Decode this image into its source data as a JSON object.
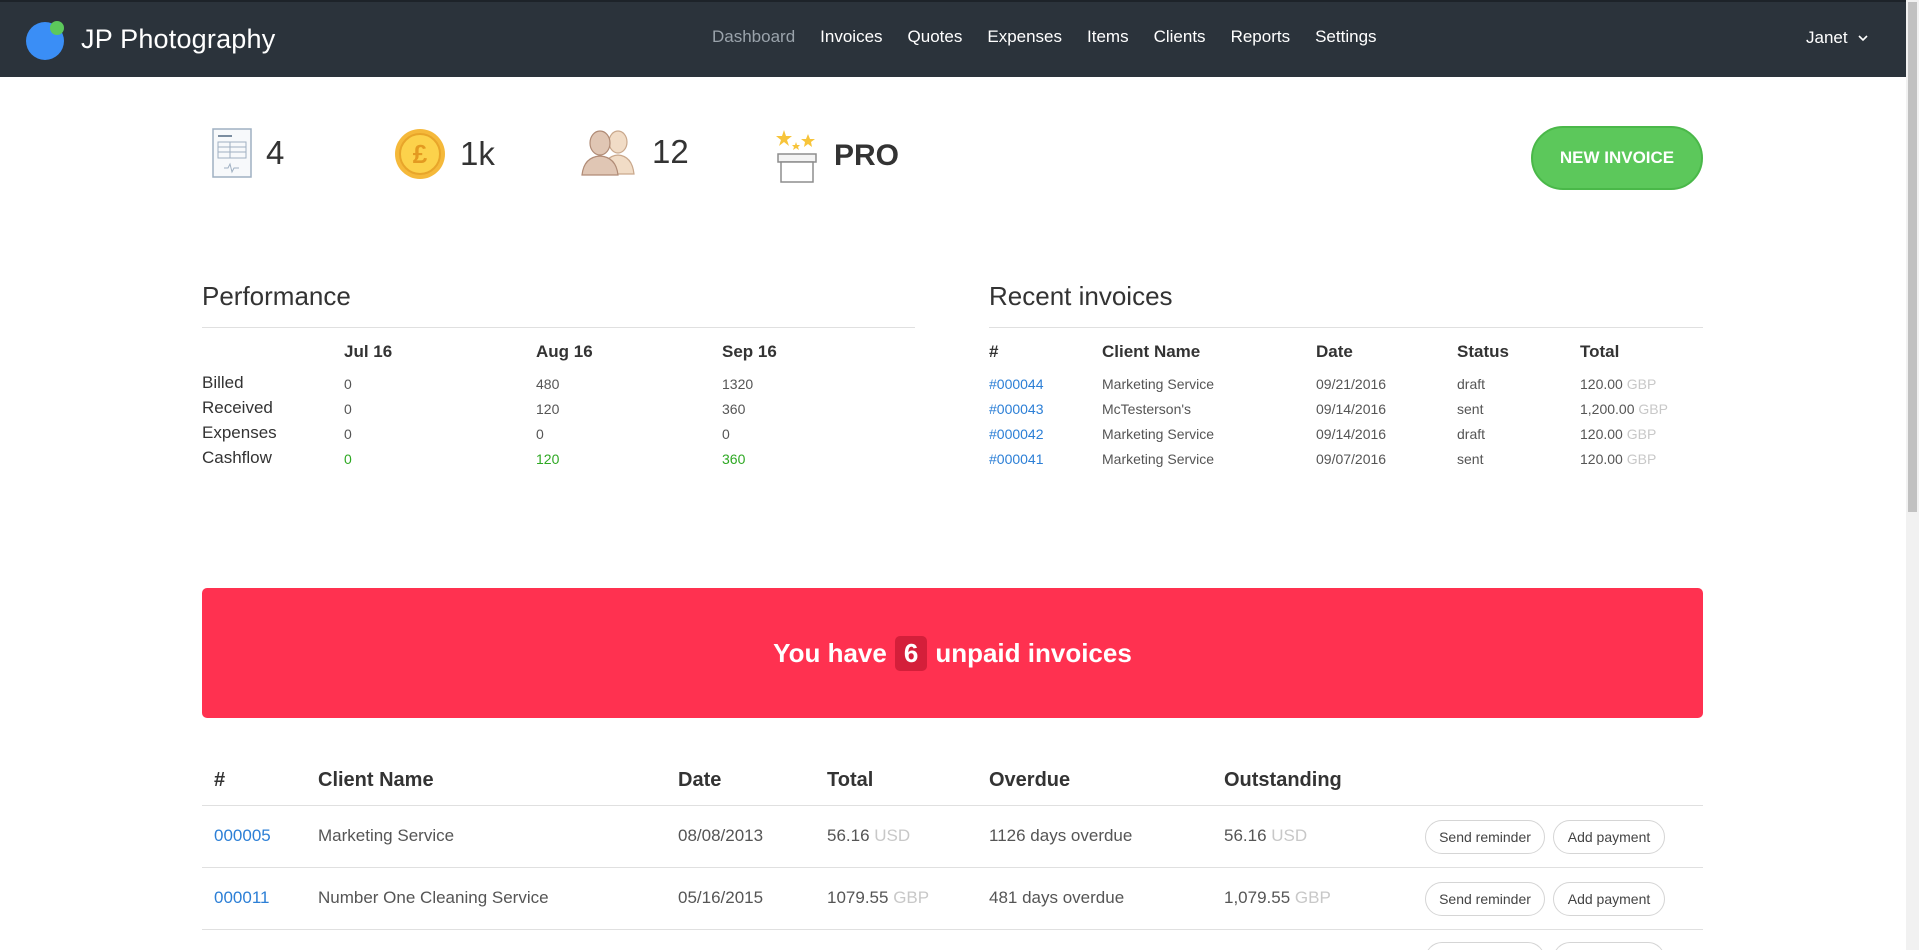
{
  "brand": {
    "name": "JP Photography"
  },
  "nav": {
    "items": [
      {
        "label": "Dashboard",
        "active": true
      },
      {
        "label": "Invoices"
      },
      {
        "label": "Quotes"
      },
      {
        "label": "Expenses"
      },
      {
        "label": "Items"
      },
      {
        "label": "Clients"
      },
      {
        "label": "Reports"
      },
      {
        "label": "Settings"
      }
    ],
    "user": "Janet"
  },
  "stats": {
    "invoices": "4",
    "revenue": "1k",
    "clients": "12",
    "plan": "PRO"
  },
  "actions": {
    "new_invoice": "NEW INVOICE"
  },
  "performance": {
    "title": "Performance",
    "columns": [
      "Jul 16",
      "Aug 16",
      "Sep 16"
    ],
    "rows": [
      {
        "label": "Billed",
        "values": [
          "0",
          "480",
          "1320"
        ]
      },
      {
        "label": "Received",
        "values": [
          "0",
          "120",
          "360"
        ]
      },
      {
        "label": "Expenses",
        "values": [
          "0",
          "0",
          "0"
        ]
      },
      {
        "label": "Cashflow",
        "values": [
          "0",
          "120",
          "360"
        ]
      }
    ]
  },
  "recent_invoices": {
    "title": "Recent invoices",
    "headers": [
      "#",
      "Client Name",
      "Date",
      "Status",
      "Total"
    ],
    "rows": [
      {
        "number": "#000044",
        "client": "Marketing Service",
        "date": "09/21/2016",
        "status": "draft",
        "total": "120.00",
        "currency": "GBP"
      },
      {
        "number": "#000043",
        "client": "McTesterson's",
        "date": "09/14/2016",
        "status": "sent",
        "total": "1,200.00",
        "currency": "GBP"
      },
      {
        "number": "#000042",
        "client": "Marketing Service",
        "date": "09/14/2016",
        "status": "draft",
        "total": "120.00",
        "currency": "GBP"
      },
      {
        "number": "#000041",
        "client": "Marketing Service",
        "date": "09/07/2016",
        "status": "sent",
        "total": "120.00",
        "currency": "GBP"
      }
    ]
  },
  "unpaid": {
    "banner_prefix": "You have",
    "count": "6",
    "banner_suffix": "unpaid invoices",
    "headers": [
      "#",
      "Client Name",
      "Date",
      "Total",
      "Overdue",
      "Outstanding"
    ],
    "rows": [
      {
        "number": "000005",
        "client": "Marketing Service",
        "date": "08/08/2013",
        "total": "56.16",
        "total_currency": "USD",
        "overdue": "1126 days overdue",
        "outstanding": "56.16",
        "outstanding_currency": "USD"
      },
      {
        "number": "000011",
        "client": "Number One Cleaning Service",
        "date": "05/16/2015",
        "total": "1079.55",
        "total_currency": "GBP",
        "overdue": "481 days overdue",
        "outstanding": "1,079.55",
        "outstanding_currency": "GBP"
      }
    ],
    "send_reminder": "Send reminder",
    "add_payment": "Add payment"
  },
  "colors": {
    "nav_bg": "#2b333b",
    "accent_green": "#5cc85b",
    "banner_red": "#ff3150",
    "link_blue": "#2c7fd6",
    "positive_green": "#2ea823"
  }
}
